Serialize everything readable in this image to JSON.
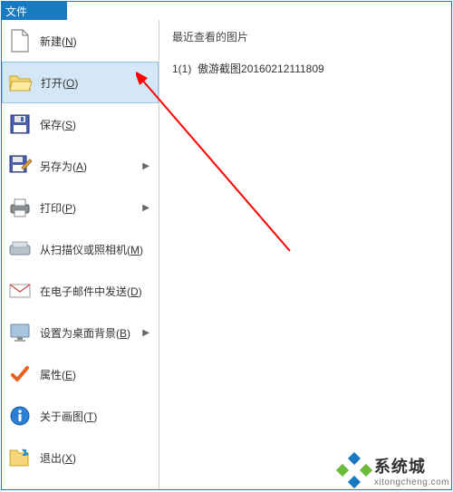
{
  "titlebar": {
    "title": "文件"
  },
  "menu": {
    "items": [
      {
        "label": "新建(N)",
        "has_submenu": false
      },
      {
        "label": "打开(O)",
        "has_submenu": false,
        "selected": true
      },
      {
        "label": "保存(S)",
        "has_submenu": false
      },
      {
        "label": "另存为(A)",
        "has_submenu": true
      },
      {
        "label": "打印(P)",
        "has_submenu": true
      },
      {
        "label": "从扫描仪或照相机(M)",
        "has_submenu": false
      },
      {
        "label": "在电子邮件中发送(D)",
        "has_submenu": false
      },
      {
        "label": "设置为桌面背景(B)",
        "has_submenu": true
      },
      {
        "label": "属性(E)",
        "has_submenu": false
      },
      {
        "label": "关于画图(T)",
        "has_submenu": false
      },
      {
        "label": "退出(X)",
        "has_submenu": false
      }
    ]
  },
  "content": {
    "header": "最近查看的图片",
    "recent": [
      {
        "index": "1(1)",
        "name": "傲游截图20160212111809"
      }
    ]
  },
  "watermark": {
    "main": "系统城",
    "sub": "xitongcheng.com"
  }
}
